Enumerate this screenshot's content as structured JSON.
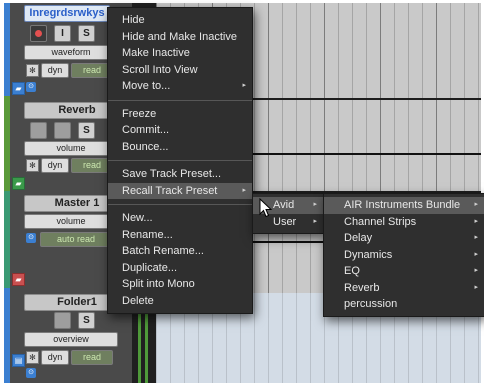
{
  "tracks": [
    {
      "name": "Inregrdsrwkys",
      "selected": true,
      "color": "#3b7fd1",
      "view": "waveform",
      "mode": "dyn",
      "auto": "read",
      "has_rec": true,
      "has_input": true
    },
    {
      "name": "Reverb",
      "selected": false,
      "color": "#5a9a3a",
      "view": "volume",
      "mode": "dyn",
      "auto": "read",
      "has_rec": false,
      "has_input": false
    },
    {
      "name": "Master 1",
      "selected": false,
      "color": "#3a9a74",
      "view": "volume",
      "mode": "",
      "auto": "auto read",
      "has_rec": false,
      "has_input": false
    },
    {
      "name": "Folder1",
      "selected": false,
      "color": "#3b7fd1",
      "view": "overview",
      "mode": "dyn",
      "auto": "read",
      "has_rec": false,
      "has_input": false
    }
  ],
  "solo_label": "S",
  "input_label": "I",
  "context_menu": {
    "groups": [
      [
        {
          "label": "Hide",
          "submenu": false
        },
        {
          "label": "Hide and Make Inactive",
          "submenu": false
        },
        {
          "label": "Make Inactive",
          "submenu": false
        },
        {
          "label": "Scroll Into View",
          "submenu": false
        },
        {
          "label": "Move to...",
          "submenu": true
        }
      ],
      [
        {
          "label": "Freeze",
          "submenu": false
        },
        {
          "label": "Commit...",
          "submenu": false
        },
        {
          "label": "Bounce...",
          "submenu": false
        }
      ],
      [
        {
          "label": "Save Track Preset...",
          "submenu": false
        },
        {
          "label": "Recall Track Preset",
          "submenu": true,
          "highlighted": true
        }
      ],
      [
        {
          "label": "New...",
          "submenu": false
        },
        {
          "label": "Rename...",
          "submenu": false
        },
        {
          "label": "Batch Rename...",
          "submenu": false
        },
        {
          "label": "Duplicate...",
          "submenu": false
        },
        {
          "label": "Split into Mono",
          "submenu": false
        },
        {
          "label": "Delete",
          "submenu": false
        }
      ]
    ]
  },
  "preset_submenu": [
    {
      "label": "Avid",
      "submenu": true,
      "highlighted": true
    },
    {
      "label": "User",
      "submenu": true
    }
  ],
  "avid_submenu": [
    {
      "label": "AIR Instruments Bundle",
      "submenu": true,
      "highlighted": true
    },
    {
      "label": "Channel Strips",
      "submenu": true
    },
    {
      "label": "Delay",
      "submenu": true
    },
    {
      "label": "Dynamics",
      "submenu": true
    },
    {
      "label": "EQ",
      "submenu": true
    },
    {
      "label": "Reverb",
      "submenu": true
    },
    {
      "label": "percussion",
      "submenu": false
    }
  ],
  "colors": {
    "menu_bg": "#2f2f2f",
    "menu_highlight": "#5a5a5a",
    "selected_track_text": "#2b60c9",
    "grid": "#c9c9c9"
  },
  "icons": {
    "arrow": "submenu-arrow-icon",
    "cursor": "mouse-pointer-icon"
  }
}
